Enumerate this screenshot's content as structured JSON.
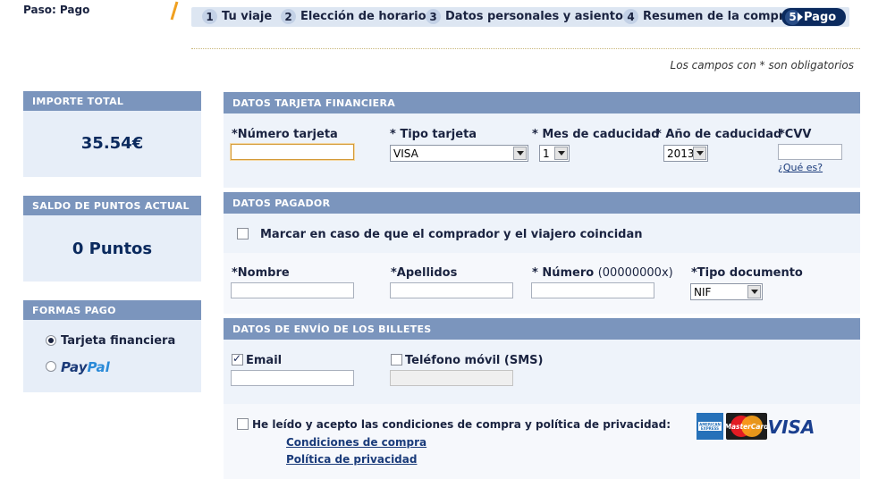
{
  "header": {
    "step_label": "Paso: Pago",
    "steps": [
      {
        "num": "1",
        "label": "Tu viaje"
      },
      {
        "num": "2",
        "label": "Elección de horario"
      },
      {
        "num": "3",
        "label": "Datos personales y asientos"
      },
      {
        "num": "4",
        "label": "Resumen de la compra"
      }
    ],
    "active_step": {
      "num": "5",
      "label": "Pago"
    },
    "required_note": "Los campos con * son obligatorios"
  },
  "sidebar": {
    "total": {
      "title": "IMPORTE TOTAL",
      "value": "35.54€"
    },
    "points": {
      "title": "SALDO DE PUNTOS ACTUAL",
      "value": "0 Puntos"
    },
    "payment": {
      "title": "FORMAS PAGO",
      "options": [
        {
          "label": "Tarjeta financiera",
          "selected": true
        },
        {
          "label_part1": "Pay",
          "label_part2": "Pal",
          "selected": false
        }
      ]
    }
  },
  "card": {
    "title": "DATOS TARJETA FINANCIERA",
    "number_label": "*Número tarjeta",
    "number_value": "",
    "type_label": "* Tipo tarjeta",
    "type_value": "VISA",
    "month_label": "* Mes de caducidad",
    "month_value": "1",
    "year_label": "* Año de caducidad",
    "year_value": "2013",
    "cvv_label": "*CVV",
    "cvv_value": "",
    "cvv_help": "¿Qué es?"
  },
  "payer": {
    "title": "DATOS PAGADOR",
    "same_checkbox_label": "Marcar en caso de que el comprador y el viajero coincidan",
    "name_label": "*Nombre",
    "surname_label": "*Apellidos",
    "number_label": "* Número",
    "number_hint": "(00000000x)",
    "doc_type_label": "*Tipo documento",
    "doc_type_value": "NIF"
  },
  "delivery": {
    "title": "DATOS DE ENVÍO DE LOS BILLETES",
    "email_label": "Email",
    "sms_label": "Teléfono móvil (SMS)",
    "terms_label": "He leído y acepto las condiciones de compra y política de privacidad:",
    "conditions_link": "Condiciones de compra",
    "privacy_link": "Política de privacidad"
  },
  "logos": {
    "amex": "AMERICAN EXPRESS",
    "mastercard": "MasterCard",
    "visa": "VISA"
  },
  "colors": {
    "header_blue": "#7b95bd",
    "panel_bg": "#e7eef8",
    "navy": "#0b2a5e"
  }
}
